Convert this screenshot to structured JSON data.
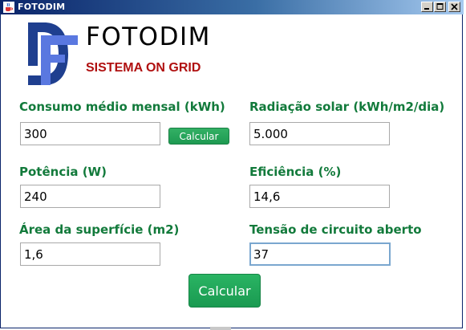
{
  "window": {
    "title": "FOTODIM"
  },
  "brand": {
    "name": "FOTODIM",
    "subtitle": "SISTEMA ON GRID"
  },
  "colors": {
    "label": "#127a3b",
    "subtitle": "#b01010",
    "button": "#1e9a52",
    "logo_dark": "#1f3f8f",
    "logo_light": "#5a78e0"
  },
  "form": {
    "consumo": {
      "label": "Consumo médio mensal (kWh)",
      "value": "300"
    },
    "radiacao": {
      "label": "Radiação solar (kWh/m2/dia)",
      "value": "5.000"
    },
    "potencia": {
      "label": "Potência (W)",
      "value": "240"
    },
    "eficiencia": {
      "label": "Eficiência (%)",
      "value": "14,6"
    },
    "area": {
      "label": "Área da superfície (m2)",
      "value": "1,6"
    },
    "tensao": {
      "label": "Tensão de circuito aberto",
      "value": "37"
    }
  },
  "buttons": {
    "small_calc": "Calcular",
    "main_calc": "Calcular"
  }
}
